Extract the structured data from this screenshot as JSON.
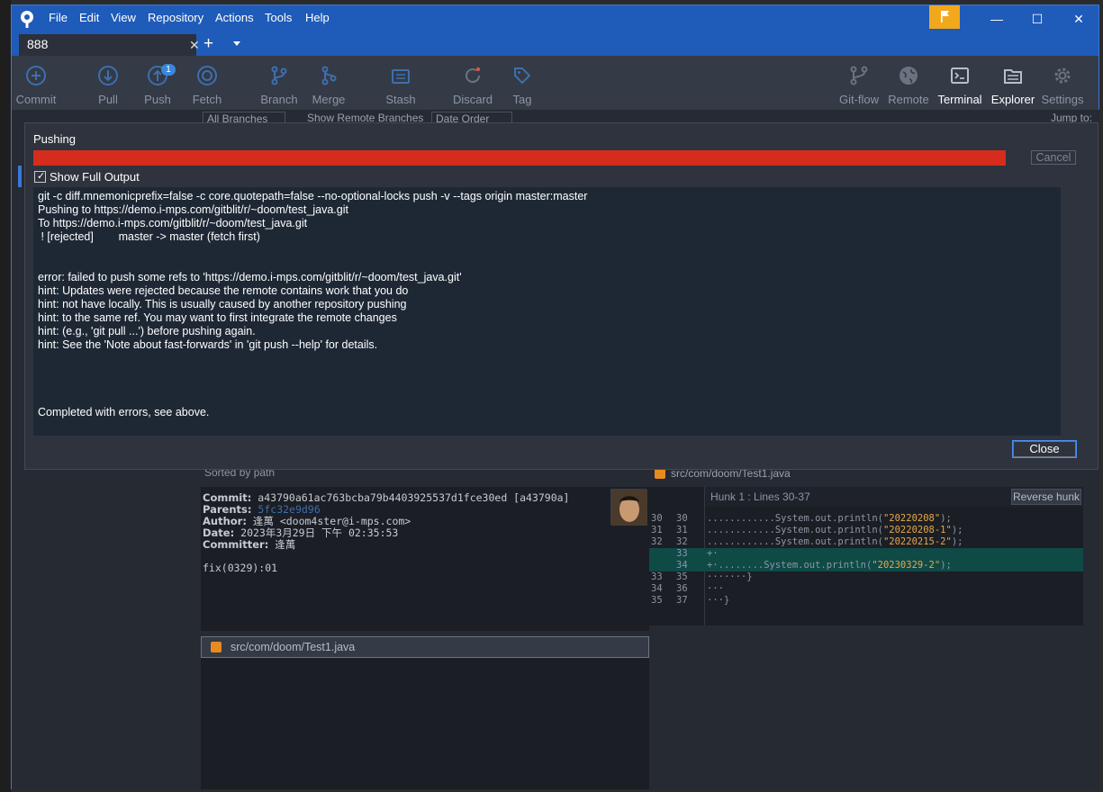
{
  "app": {
    "menu": [
      "File",
      "Edit",
      "View",
      "Repository",
      "Actions",
      "Tools",
      "Help"
    ],
    "colors": {
      "titlebar": "#1f5bb8",
      "toolbar": "#343a46",
      "progress_error": "#d62c1e",
      "flag": "#f2a81d"
    }
  },
  "tabs": [
    {
      "label": "888"
    }
  ],
  "window_controls": {
    "minimize": "—",
    "maximize": "☐",
    "close": "✕"
  },
  "toolbar": {
    "left": [
      {
        "label": "Commit",
        "icon": "plus-circle-icon"
      },
      {
        "label": "Pull",
        "icon": "arrow-down-circle-icon"
      },
      {
        "label": "Push",
        "icon": "arrow-up-circle-icon",
        "badge": "1"
      },
      {
        "label": "Fetch",
        "icon": "fetch-circle-icon"
      },
      {
        "label": "Branch",
        "icon": "branch-icon"
      },
      {
        "label": "Merge",
        "icon": "merge-icon"
      },
      {
        "label": "Stash",
        "icon": "stash-icon"
      },
      {
        "label": "Discard",
        "icon": "discard-icon"
      },
      {
        "label": "Tag",
        "icon": "tag-icon"
      }
    ],
    "right": [
      {
        "label": "Git-flow",
        "icon": "gitflow-icon"
      },
      {
        "label": "Remote",
        "icon": "globe-icon"
      },
      {
        "label": "Terminal",
        "icon": "terminal-icon"
      },
      {
        "label": "Explorer",
        "icon": "folder-icon"
      },
      {
        "label": "Settings",
        "icon": "gear-icon"
      }
    ]
  },
  "filters": {
    "branches": "All Branches",
    "show_remote": "Show Remote Branches",
    "order": "Date Order",
    "jump_to": "Jump to:"
  },
  "modal": {
    "title": "Pushing",
    "progress": 1.0,
    "cancel_label": "Cancel",
    "show_full_output_label": "Show Full Output",
    "show_full_output_checked": true,
    "output_lines": [
      "git -c diff.mnemonicprefix=false -c core.quotepath=false --no-optional-locks push -v --tags origin master:master",
      "Pushing to https://demo.i-mps.com/gitblit/r/~doom/test_java.git",
      "To https://demo.i-mps.com/gitblit/r/~doom/test_java.git",
      " ! [rejected]        master -> master (fetch first)",
      "",
      "",
      "error: failed to push some refs to 'https://demo.i-mps.com/gitblit/r/~doom/test_java.git'",
      "hint: Updates were rejected because the remote contains work that you do",
      "hint: not have locally. This is usually caused by another repository pushing",
      "hint: to the same ref. You may want to first integrate the remote changes",
      "hint: (e.g., 'git pull ...') before pushing again.",
      "hint: See the 'Note about fast-forwards' in 'git push --help' for details.",
      "",
      "",
      "",
      "",
      "Completed with errors, see above."
    ],
    "close_label": "Close"
  },
  "commit": {
    "sort_label": "Sorted by path",
    "commit_label": "Commit:",
    "commit_value": "a43790a61ac763bcba79b4403925537d1fce30ed [a43790a]",
    "parents_label": "Parents:",
    "parents_value": "5fc32e9d96",
    "author_label": "Author:",
    "author_value": "逢萬 <doom4ster@i-mps.com>",
    "date_label": "Date:",
    "date_value": "2023年3月29日 下午 02:35:53",
    "committer_label": "Committer:",
    "committer_value": "逢萬",
    "message": "fix(0329):01",
    "file": "src/com/doom/Test1.java"
  },
  "diff": {
    "file": "src/com/doom/Test1.java",
    "hunk_label": "Hunk 1 : Lines 30-37",
    "reverse_hunk_label": "Reverse hunk",
    "lines": [
      {
        "old": "30",
        "new": "30",
        "prefix": "............System.out.println(",
        "str": "\"20220208\"",
        "suffix": ");",
        "added": false
      },
      {
        "old": "31",
        "new": "31",
        "prefix": "............System.out.println(",
        "str": "\"20220208-1\"",
        "suffix": ");",
        "added": false
      },
      {
        "old": "32",
        "new": "32",
        "prefix": "............System.out.println(",
        "str": "\"20220215-2\"",
        "suffix": ");",
        "added": false
      },
      {
        "old": "",
        "new": "33",
        "prefix": "+·",
        "str": "",
        "suffix": "",
        "added": true
      },
      {
        "old": "",
        "new": "34",
        "prefix": "+·........System.out.println(",
        "str": "\"20230329-2\"",
        "suffix": ");",
        "added": true
      },
      {
        "old": "33",
        "new": "35",
        "prefix": "·······}",
        "str": "",
        "suffix": "",
        "added": false
      },
      {
        "old": "34",
        "new": "36",
        "prefix": "···",
        "str": "",
        "suffix": "",
        "added": false
      },
      {
        "old": "35",
        "new": "37",
        "prefix": "···}",
        "str": "",
        "suffix": "",
        "added": false
      }
    ]
  }
}
